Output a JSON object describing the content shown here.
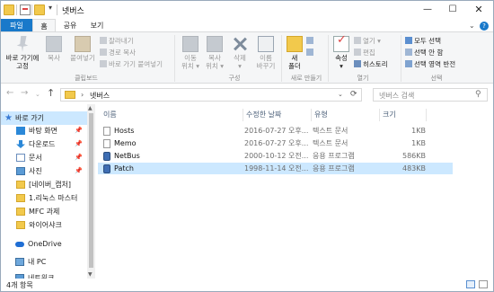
{
  "window": {
    "title": "넷버스",
    "qa_arrow": "▾",
    "min": "—",
    "max": "☐",
    "close": "✕"
  },
  "tabs": {
    "file": "파일",
    "home": "홈",
    "share": "공유",
    "view": "보기",
    "expand": "⌄",
    "help": "?"
  },
  "ribbon": {
    "clipboard": {
      "pin": "바로 가기에\n고정",
      "copy": "복사",
      "paste": "붙여넣기",
      "cut": "잘라내기",
      "copy_path": "경로 복사",
      "paste_shortcut": "바로 가기 붙여넣기",
      "label": "클립보드"
    },
    "organize": {
      "move_to": "이동\n위치 ▾",
      "copy_to": "복사\n위치 ▾",
      "delete": "삭제\n▾",
      "rename": "이름\n바꾸기",
      "label": "구성"
    },
    "new": {
      "new_folder": "새\n폴더",
      "label": "새로 만들기"
    },
    "open": {
      "properties": "속성\n▾",
      "open": "열기 ▾",
      "edit": "편집",
      "history": "히스토리",
      "label": "열기"
    },
    "select": {
      "select_all": "모두 선택",
      "select_none": "선택 안 함",
      "invert": "선택 영역 반전",
      "label": "선택"
    }
  },
  "nav": {
    "back": "←",
    "forward": "→",
    "recent": "⌄",
    "up": "↑",
    "breadcrumb_sep": "›",
    "path": "넷버스",
    "dropdown": "⌄",
    "refresh": "⟳",
    "search_placeholder": "넷버스 검색",
    "search_icon": "⚲"
  },
  "navpane": {
    "items": [
      {
        "label": "바로 가기",
        "icon": "star-icon",
        "pin": ""
      },
      {
        "label": "바탕 화면",
        "icon": "desktop-icon",
        "pin": "📌"
      },
      {
        "label": "다운로드",
        "icon": "download-icon",
        "pin": "📌"
      },
      {
        "label": "문서",
        "icon": "document-icon",
        "pin": "📌"
      },
      {
        "label": "사진",
        "icon": "picture-icon",
        "pin": "📌"
      },
      {
        "label": "[네이버_캡처]",
        "icon": "folder-icon",
        "pin": ""
      },
      {
        "label": "1.리눅스 마스터",
        "icon": "folder-icon",
        "pin": ""
      },
      {
        "label": "MFC 과제",
        "icon": "folder-icon",
        "pin": ""
      },
      {
        "label": "와이어샤크",
        "icon": "folder-icon",
        "pin": ""
      },
      {
        "label": "OneDrive",
        "icon": "onedrive-icon",
        "pin": ""
      },
      {
        "label": "내 PC",
        "icon": "pc-icon",
        "pin": ""
      },
      {
        "label": "네트워크",
        "icon": "network-icon",
        "pin": ""
      }
    ],
    "scroll_up": "▲",
    "scroll_down": "▼"
  },
  "filelist": {
    "columns": {
      "name": "이름",
      "date": "수정한 날짜",
      "type": "유형",
      "size": "크기"
    },
    "rows": [
      {
        "name": "Hosts",
        "date": "2016-07-27 오후...",
        "type": "텍스트 문서",
        "size": "1KB",
        "kind": "text"
      },
      {
        "name": "Memo",
        "date": "2016-07-27 오후...",
        "type": "텍스트 문서",
        "size": "1KB",
        "kind": "text"
      },
      {
        "name": "NetBus",
        "date": "2000-10-12 오전...",
        "type": "응용 프로그램",
        "size": "586KB",
        "kind": "exe"
      },
      {
        "name": "Patch",
        "date": "1998-11-14 오전...",
        "type": "응용 프로그램",
        "size": "483KB",
        "kind": "exe"
      }
    ]
  },
  "status": {
    "count": "4개 항목"
  }
}
